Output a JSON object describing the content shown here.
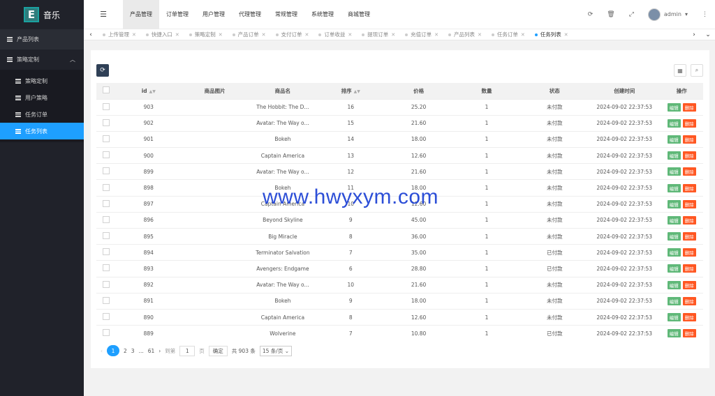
{
  "app": {
    "logo_letter": "E",
    "name": "音乐"
  },
  "sidebar": {
    "top_item": "产品列表",
    "group": "策略定制",
    "items": [
      {
        "label": "策略定制"
      },
      {
        "label": "用户策略"
      },
      {
        "label": "任务订单"
      },
      {
        "label": "任务列表"
      }
    ]
  },
  "topbar": {
    "menu": [
      "产品管理",
      "订单管理",
      "用户管理",
      "代理管理",
      "常规管理",
      "系统管理",
      "商城管理"
    ],
    "user": "admin"
  },
  "tabs": [
    "上传管理",
    "快捷入口",
    "策略定制",
    "产品订单",
    "支付订单",
    "订单收益",
    "提现订单",
    "充值订单",
    "产品列表",
    "任务订单",
    "任务列表"
  ],
  "table": {
    "headers": [
      "id",
      "商品图片",
      "商品名",
      "排序",
      "价格",
      "数量",
      "状态",
      "创建时间",
      "操作"
    ],
    "edit_label": "编辑",
    "delete_label": "删除",
    "rows": [
      {
        "id": "903",
        "name": "The Hobbit: The D...",
        "sort": "16",
        "price": "25.20",
        "qty": "1",
        "status": "未付款",
        "time": "2024-09-02 22:37:53"
      },
      {
        "id": "902",
        "name": "Avatar: The Way o...",
        "sort": "15",
        "price": "21.60",
        "qty": "1",
        "status": "未付款",
        "time": "2024-09-02 22:37:53"
      },
      {
        "id": "901",
        "name": "Bokeh",
        "sort": "14",
        "price": "18.00",
        "qty": "1",
        "status": "未付款",
        "time": "2024-09-02 22:37:53"
      },
      {
        "id": "900",
        "name": "Captain America",
        "sort": "13",
        "price": "12.60",
        "qty": "1",
        "status": "未付款",
        "time": "2024-09-02 22:37:53"
      },
      {
        "id": "899",
        "name": "Avatar: The Way o...",
        "sort": "12",
        "price": "21.60",
        "qty": "1",
        "status": "未付款",
        "time": "2024-09-02 22:37:53"
      },
      {
        "id": "898",
        "name": "Bokeh",
        "sort": "11",
        "price": "18.00",
        "qty": "1",
        "status": "未付款",
        "time": "2024-09-02 22:37:53"
      },
      {
        "id": "897",
        "name": "Captain America",
        "sort": "10",
        "price": "12.60",
        "qty": "1",
        "status": "未付款",
        "time": "2024-09-02 22:37:53"
      },
      {
        "id": "896",
        "name": "Beyond Skyline",
        "sort": "9",
        "price": "45.00",
        "qty": "1",
        "status": "未付款",
        "time": "2024-09-02 22:37:53"
      },
      {
        "id": "895",
        "name": "Big Miracle",
        "sort": "8",
        "price": "36.00",
        "qty": "1",
        "status": "未付款",
        "time": "2024-09-02 22:37:53"
      },
      {
        "id": "894",
        "name": "Terminator Salvation",
        "sort": "7",
        "price": "35.00",
        "qty": "1",
        "status": "已付款",
        "time": "2024-09-02 22:37:53"
      },
      {
        "id": "893",
        "name": "Avengers: Endgame",
        "sort": "6",
        "price": "28.80",
        "qty": "1",
        "status": "已付款",
        "time": "2024-09-02 22:37:53"
      },
      {
        "id": "892",
        "name": "Avatar: The Way o...",
        "sort": "10",
        "price": "21.60",
        "qty": "1",
        "status": "未付款",
        "time": "2024-09-02 22:37:53"
      },
      {
        "id": "891",
        "name": "Bokeh",
        "sort": "9",
        "price": "18.00",
        "qty": "1",
        "status": "未付款",
        "time": "2024-09-02 22:37:53"
      },
      {
        "id": "890",
        "name": "Captain America",
        "sort": "8",
        "price": "12.60",
        "qty": "1",
        "status": "未付款",
        "time": "2024-09-02 22:37:53"
      },
      {
        "id": "889",
        "name": "Wolverine",
        "sort": "7",
        "price": "10.80",
        "qty": "1",
        "status": "已付款",
        "time": "2024-09-02 22:37:53"
      }
    ]
  },
  "pager": {
    "pages": [
      "2",
      "3",
      "...",
      "61"
    ],
    "current": "1",
    "goto_label": "到第",
    "goto_value": "1",
    "page_unit": "页",
    "confirm": "确定",
    "total": "共 903 条",
    "per_page": "15 条/页"
  },
  "watermark": "www.hwyxym.com",
  "colors": {
    "sidebar_bg": "#20222a",
    "active_blue": "#1e9fff",
    "edit_green": "#5fb878",
    "delete_red": "#ff5722"
  }
}
